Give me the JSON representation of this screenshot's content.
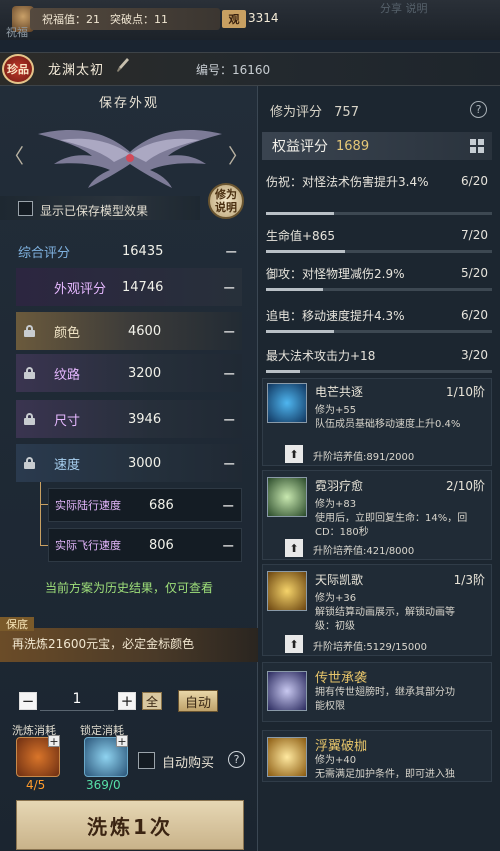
{
  "topbar": {
    "corner_label": "祝福",
    "blessing": "祝福值：21",
    "breakthrough": "突破点：11",
    "guan_label": "观",
    "guan_value": "3314",
    "faint_text": "分享    说明"
  },
  "item": {
    "rarity": "珍品",
    "name": "龙渊太初",
    "serial": "编号：16160"
  },
  "left": {
    "saved_look_title": "保存外观",
    "show_model_label": "显示已保存模型效果",
    "explain_button": "修为说明",
    "scores": [
      {
        "label": "综合评分",
        "value": "16435",
        "minus": "−"
      },
      {
        "label": "外观评分",
        "value": "14746",
        "minus": "−"
      },
      {
        "label": "颜色",
        "value": "4600",
        "minus": "−"
      },
      {
        "label": "纹路",
        "value": "3200",
        "minus": "−"
      },
      {
        "label": "尺寸",
        "value": "3946",
        "minus": "−"
      },
      {
        "label": "速度",
        "value": "3000",
        "minus": "−"
      },
      {
        "label": "实际陆行速度",
        "value": "686",
        "minus": "−"
      },
      {
        "label": "实际飞行速度",
        "value": "806",
        "minus": "−"
      }
    ],
    "history_note": "当前方案为历史结果，仅可查看",
    "guarantee_tag": "保底",
    "guarantee_text": "再洗炼21600元宝，必定金标颜色",
    "qty_minus": "−",
    "qty_value": "1",
    "qty_plus": "+",
    "qty_all": "全",
    "auto_button": "自动",
    "refine_cost_label": "洗炼消耗",
    "lock_cost_label": "锁定消耗",
    "refine_count": "4/5",
    "lock_count": "369/0",
    "auto_buy_label": "自动购买",
    "help": "?",
    "refine_button": "洗炼1次",
    "arrow_left": "〈",
    "arrow_right": "〉",
    "plus": "+"
  },
  "right": {
    "cultivation_label": "修为评分",
    "cultivation_value": "757",
    "help": "?",
    "rights_title": "权益评分",
    "rights_value": "1689",
    "attributes": [
      {
        "text": "伤祝：对怪法术伤害提升3.4%",
        "count": "6/20",
        "progress": 0.3
      },
      {
        "text": "生命值+865",
        "count": "7/20",
        "progress": 0.35
      },
      {
        "text": "御攻：对怪物理减伤2.9%",
        "count": "5/20",
        "progress": 0.25
      },
      {
        "text": "追电：移动速度提升4.3%",
        "count": "6/20",
        "progress": 0.3
      },
      {
        "text": "最大法术攻击力+18",
        "count": "3/20",
        "progress": 0.15
      }
    ],
    "skills": [
      {
        "name": "电芒共逐",
        "level": "1/10阶",
        "desc1": "修为+55",
        "desc2": "队伍成员基础移动速度上升0.4%",
        "desc3": "",
        "upgrade": "升阶培养值:891/2000",
        "icon": "lightning-runner-icon"
      },
      {
        "name": "霓羽疗愈",
        "level": "2/10阶",
        "desc1": "修为+83",
        "desc2": "使用后，立即回复生命：14%，回",
        "desc3": "CD：180秒",
        "upgrade": "升阶培养值:421/8000",
        "icon": "healing-figure-icon"
      },
      {
        "name": "天际凯歌",
        "level": "1/3阶",
        "desc1": "修为+36",
        "desc2": "解锁结算动画展示，解锁动画等",
        "desc3": "级：初级",
        "upgrade": "升阶培养值:5129/15000",
        "icon": "golden-horn-icon"
      }
    ],
    "legendary": [
      {
        "name": "传世承袭",
        "desc1": "拥有传世翅膀时，继承其部分功",
        "desc2": "能权限",
        "icon": "legacy-wing-icon"
      },
      {
        "name": "浮翼破枷",
        "desc1": "修为+40",
        "desc2": "无需满足加护条件，即可进入独",
        "icon": "golden-wing-icon"
      }
    ],
    "upgrade_arrow": "⬆"
  },
  "colors": {
    "accent_gold": "#e5c878",
    "score_purple": "#e6b8ff",
    "overall_blue": "#7fb2e0",
    "note_green": "#9fe07a",
    "refine_orange": "#ff9b2c",
    "lock_green": "#57e0a8"
  }
}
